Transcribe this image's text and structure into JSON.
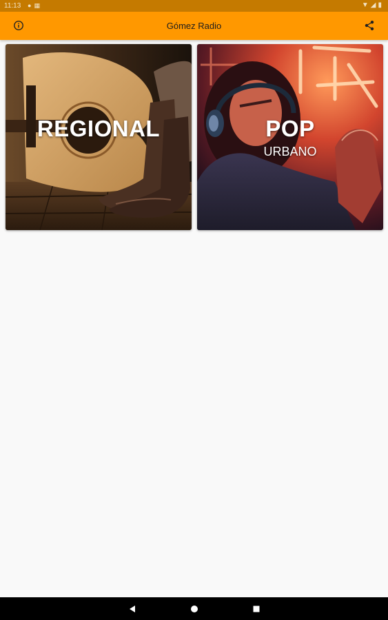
{
  "status_bar": {
    "time": "11:13",
    "left_icons": [
      "sync-icon",
      "sd-card-icon"
    ],
    "right_icons": [
      "wifi-icon",
      "signal-icon",
      "battery-icon"
    ]
  },
  "app_bar": {
    "title": "Gómez Radio",
    "leading_icon": "info-icon",
    "trailing_icon": "share-icon",
    "color": "#ff9800"
  },
  "stations": [
    {
      "label": "REGIONAL",
      "sublabel": "",
      "image": "guitar-and-cowboy-boots"
    },
    {
      "label": "POP",
      "sublabel": "URBANO",
      "image": "woman-with-headphones-neon"
    }
  ],
  "nav_bar": {
    "buttons": [
      "back-icon",
      "home-icon",
      "recents-icon"
    ]
  }
}
